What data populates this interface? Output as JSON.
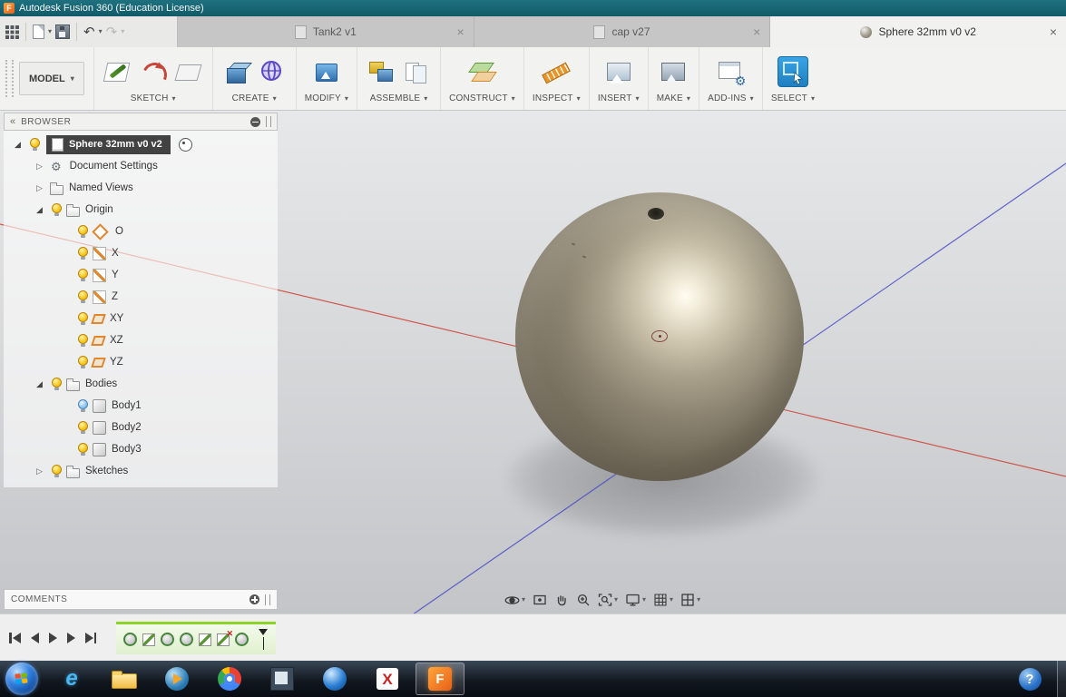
{
  "window": {
    "title": "Autodesk Fusion 360 (Education License)"
  },
  "quick_access": {
    "icons": [
      "apps-grid",
      "file-new",
      "save",
      "undo",
      "redo"
    ]
  },
  "document_tabs": {
    "tabs": [
      {
        "label": "Tank2 v1",
        "close": "×"
      },
      {
        "label": "cap v27",
        "close": "×"
      },
      {
        "label": "Sphere 32mm v0 v2",
        "close": "×",
        "active": true
      }
    ]
  },
  "ribbon": {
    "workspace_label": "MODEL",
    "groups": [
      {
        "label": "SKETCH"
      },
      {
        "label": "CREATE"
      },
      {
        "label": "MODIFY"
      },
      {
        "label": "ASSEMBLE"
      },
      {
        "label": "CONSTRUCT"
      },
      {
        "label": "INSPECT"
      },
      {
        "label": "INSERT"
      },
      {
        "label": "MAKE"
      },
      {
        "label": "ADD-INS"
      },
      {
        "label": "SELECT"
      }
    ]
  },
  "browser": {
    "title": "BROWSER",
    "items": [
      {
        "label": "Sphere 32mm v0 v2",
        "level": 0,
        "selected": true,
        "expanded": true,
        "bulb": "yellow"
      },
      {
        "label": "Document Settings",
        "level": 1,
        "expanded": false
      },
      {
        "label": "Named Views",
        "level": 1,
        "expanded": false
      },
      {
        "label": "Origin",
        "level": 1,
        "expanded": true,
        "bulb": "yellow"
      },
      {
        "label": "O",
        "level": 2,
        "bulb": "yellow"
      },
      {
        "label": "X",
        "level": 2,
        "bulb": "yellow"
      },
      {
        "label": "Y",
        "level": 2,
        "bulb": "yellow"
      },
      {
        "label": "Z",
        "level": 2,
        "bulb": "yellow"
      },
      {
        "label": "XY",
        "level": 2,
        "bulb": "yellow"
      },
      {
        "label": "XZ",
        "level": 2,
        "bulb": "yellow"
      },
      {
        "label": "YZ",
        "level": 2,
        "bulb": "yellow"
      },
      {
        "label": "Bodies",
        "level": 1,
        "expanded": true,
        "bulb": "yellow"
      },
      {
        "label": "Body1",
        "level": 2,
        "bulb": "blue"
      },
      {
        "label": "Body2",
        "level": 2,
        "bulb": "yellow"
      },
      {
        "label": "Body3",
        "level": 2,
        "bulb": "yellow"
      },
      {
        "label": "Sketches",
        "level": 1,
        "expanded": false,
        "bulb": "yellow"
      }
    ]
  },
  "comments": {
    "title": "COMMENTS"
  },
  "view_navbar": {
    "icons": [
      "orbit",
      "look-at",
      "pan",
      "zoom",
      "fit",
      "display-settings",
      "grid-and-snaps",
      "viewports"
    ]
  },
  "timeline": {
    "playback_icons": [
      "skip-to-start",
      "step-back",
      "play",
      "step-forward",
      "skip-to-end"
    ],
    "features": [
      "sphere-feature",
      "sketch",
      "sphere-feature",
      "sphere-feature",
      "sketch",
      "sketch-error",
      "sphere-feature"
    ]
  },
  "taskbar": {
    "items": [
      "start",
      "internet-explorer",
      "file-explorer",
      "media-player",
      "chrome",
      "app-window",
      "app-sphere",
      "app-x",
      "fusion-360-active",
      "help",
      "show-desktop"
    ]
  },
  "colors": {
    "titlebar_teal": "#1a6b79",
    "select_highlight_blue": "#2b9be0",
    "bulb_yellow": "#f7c61c",
    "timeline_green": "#8cd32a",
    "axis_red": "#cf4a3e",
    "axis_blue": "#4a4cc8",
    "taskbar_dark": "#101620"
  }
}
